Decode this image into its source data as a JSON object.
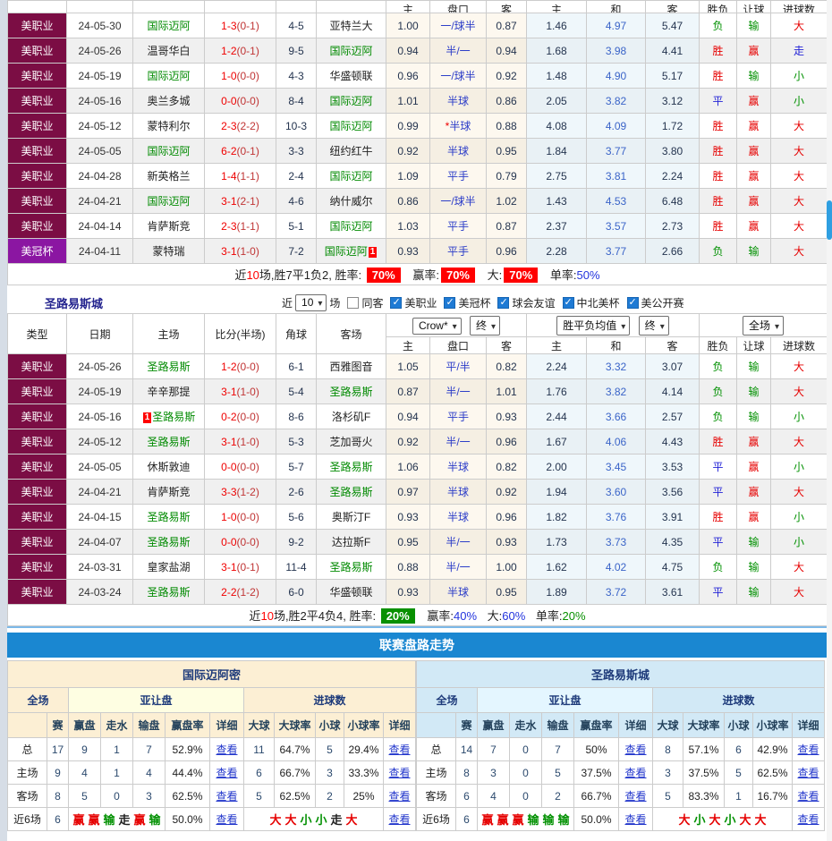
{
  "columns": {
    "left": [
      "类型",
      "日期",
      "主场",
      "比分(半场)",
      "角球",
      "客场"
    ],
    "right": [
      "主",
      "盘口",
      "客",
      "主",
      "和",
      "客",
      "胜负",
      "让球",
      "进球数"
    ]
  },
  "table1": {
    "rows": [
      {
        "league": "美职业",
        "cup": false,
        "date": "24-05-30",
        "home": {
          "name": "国际迈阿",
          "hl": true
        },
        "score": "1-3",
        "half": "(0-1)",
        "corner": "4-5",
        "away": {
          "name": "亚特兰大",
          "hl": false
        },
        "asia": [
          "1.00",
          "一/球半",
          "0.87"
        ],
        "euro": [
          "1.46",
          "4.97",
          "5.47"
        ],
        "result": [
          "负",
          "g"
        ],
        "handicap_result": [
          "输",
          "g"
        ],
        "goal": [
          "大",
          "r"
        ]
      },
      {
        "league": "美职业",
        "cup": false,
        "date": "24-05-26",
        "home": {
          "name": "温哥华白",
          "hl": false
        },
        "score": "1-2",
        "half": "(0-1)",
        "corner": "9-5",
        "away": {
          "name": "国际迈阿",
          "hl": true
        },
        "asia": [
          "0.94",
          "半/一",
          "0.94"
        ],
        "euro": [
          "1.68",
          "3.98",
          "4.41"
        ],
        "result": [
          "胜",
          "r"
        ],
        "handicap_result": [
          "赢",
          "r"
        ],
        "goal": [
          "走",
          "b"
        ]
      },
      {
        "league": "美职业",
        "cup": false,
        "date": "24-05-19",
        "home": {
          "name": "国际迈阿",
          "hl": true
        },
        "score": "1-0",
        "half": "(0-0)",
        "corner": "4-3",
        "away": {
          "name": "华盛顿联",
          "hl": false
        },
        "asia": [
          "0.96",
          "一/球半",
          "0.92"
        ],
        "euro": [
          "1.48",
          "4.90",
          "5.17"
        ],
        "result": [
          "胜",
          "r"
        ],
        "handicap_result": [
          "输",
          "g"
        ],
        "goal": [
          "小",
          "g"
        ]
      },
      {
        "league": "美职业",
        "cup": false,
        "date": "24-05-16",
        "home": {
          "name": "奥兰多城",
          "hl": false
        },
        "score": "0-0",
        "half": "(0-0)",
        "corner": "8-4",
        "away": {
          "name": "国际迈阿",
          "hl": true
        },
        "asia": [
          "1.01",
          "半球",
          "0.86"
        ],
        "euro": [
          "2.05",
          "3.82",
          "3.12"
        ],
        "result": [
          "平",
          "b"
        ],
        "handicap_result": [
          "赢",
          "r"
        ],
        "goal": [
          "小",
          "g"
        ]
      },
      {
        "league": "美职业",
        "cup": false,
        "date": "24-05-12",
        "home": {
          "name": "蒙特利尔",
          "hl": false
        },
        "score": "2-3",
        "half": "(2-2)",
        "corner": "10-3",
        "away": {
          "name": "国际迈阿",
          "hl": true
        },
        "asia": [
          "0.99",
          "*半球",
          "0.88"
        ],
        "euro": [
          "4.08",
          "4.09",
          "1.72"
        ],
        "result": [
          "胜",
          "r"
        ],
        "handicap_result": [
          "赢",
          "r"
        ],
        "goal": [
          "大",
          "r"
        ]
      },
      {
        "league": "美职业",
        "cup": false,
        "date": "24-05-05",
        "home": {
          "name": "国际迈阿",
          "hl": true
        },
        "score": "6-2",
        "half": "(0-1)",
        "corner": "3-3",
        "away": {
          "name": "纽约红牛",
          "hl": false
        },
        "asia": [
          "0.92",
          "半球",
          "0.95"
        ],
        "euro": [
          "1.84",
          "3.77",
          "3.80"
        ],
        "result": [
          "胜",
          "r"
        ],
        "handicap_result": [
          "赢",
          "r"
        ],
        "goal": [
          "大",
          "r"
        ]
      },
      {
        "league": "美职业",
        "cup": false,
        "date": "24-04-28",
        "home": {
          "name": "新英格兰",
          "hl": false
        },
        "score": "1-4",
        "half": "(1-1)",
        "corner": "2-4",
        "away": {
          "name": "国际迈阿",
          "hl": true
        },
        "asia": [
          "1.09",
          "平手",
          "0.79"
        ],
        "euro": [
          "2.75",
          "3.81",
          "2.24"
        ],
        "result": [
          "胜",
          "r"
        ],
        "handicap_result": [
          "赢",
          "r"
        ],
        "goal": [
          "大",
          "r"
        ]
      },
      {
        "league": "美职业",
        "cup": false,
        "date": "24-04-21",
        "home": {
          "name": "国际迈阿",
          "hl": true
        },
        "score": "3-1",
        "half": "(2-1)",
        "corner": "4-6",
        "away": {
          "name": "纳什威尔",
          "hl": false
        },
        "asia": [
          "0.86",
          "一/球半",
          "1.02"
        ],
        "euro": [
          "1.43",
          "4.53",
          "6.48"
        ],
        "result": [
          "胜",
          "r"
        ],
        "handicap_result": [
          "赢",
          "r"
        ],
        "goal": [
          "大",
          "r"
        ]
      },
      {
        "league": "美职业",
        "cup": false,
        "date": "24-04-14",
        "home": {
          "name": "肯萨斯竞",
          "hl": false
        },
        "score": "2-3",
        "half": "(1-1)",
        "corner": "5-1",
        "away": {
          "name": "国际迈阿",
          "hl": true
        },
        "asia": [
          "1.03",
          "平手",
          "0.87"
        ],
        "euro": [
          "2.37",
          "3.57",
          "2.73"
        ],
        "result": [
          "胜",
          "r"
        ],
        "handicap_result": [
          "赢",
          "r"
        ],
        "goal": [
          "大",
          "r"
        ]
      },
      {
        "league": "美冠杯",
        "cup": true,
        "date": "24-04-11",
        "home": {
          "name": "蒙特瑞",
          "hl": false
        },
        "score": "3-1",
        "half": "(1-0)",
        "corner": "7-2",
        "away": {
          "name": "国际迈阿",
          "hl": true,
          "badge": "1",
          "badge_pos": "after"
        },
        "asia": [
          "0.93",
          "平手",
          "0.96"
        ],
        "euro": [
          "2.28",
          "3.77",
          "2.66"
        ],
        "result": [
          "负",
          "g"
        ],
        "handicap_result": [
          "输",
          "g"
        ],
        "goal": [
          "大",
          "r"
        ]
      }
    ],
    "summary": {
      "prefix": "近",
      "count": "10",
      "text": "场,胜7平1负2, 胜率:",
      "win_rate": "70%",
      "label_profit": "赢率:",
      "profit_rate": "70%",
      "label_big": "大:",
      "big_rate": "70%",
      "label_single": "单率:",
      "single_rate": "50%"
    }
  },
  "section2": {
    "title": "圣路易斯城",
    "near_label": "近",
    "games_select": "10",
    "games_label": "场",
    "checkboxes": [
      {
        "label": "同客",
        "checked": false
      },
      {
        "label": "美职业",
        "checked": true
      },
      {
        "label": "美冠杯",
        "checked": true
      },
      {
        "label": "球会友谊",
        "checked": true
      },
      {
        "label": "中北美杯",
        "checked": true
      },
      {
        "label": "美公开赛",
        "checked": true
      }
    ]
  },
  "table2": {
    "selects": {
      "asia_source": "Crow*",
      "asia_state": "终",
      "eu_source": "胜平负均值",
      "eu_state": "终",
      "scope": "全场"
    },
    "rows": [
      {
        "league": "美职业",
        "cup": false,
        "date": "24-05-26",
        "home": {
          "name": "圣路易斯",
          "hl": true
        },
        "score": "1-2",
        "half": "(0-0)",
        "corner": "6-1",
        "away": {
          "name": "西雅图音",
          "hl": false
        },
        "asia": [
          "1.05",
          "平/半",
          "0.82"
        ],
        "euro": [
          "2.24",
          "3.32",
          "3.07"
        ],
        "result": [
          "负",
          "g"
        ],
        "handicap_result": [
          "输",
          "g"
        ],
        "goal": [
          "大",
          "r"
        ]
      },
      {
        "league": "美职业",
        "cup": false,
        "date": "24-05-19",
        "home": {
          "name": "辛辛那提",
          "hl": false
        },
        "score": "3-1",
        "half": "(1-0)",
        "corner": "5-4",
        "away": {
          "name": "圣路易斯",
          "hl": true
        },
        "asia": [
          "0.87",
          "半/一",
          "1.01"
        ],
        "euro": [
          "1.76",
          "3.82",
          "4.14"
        ],
        "result": [
          "负",
          "g"
        ],
        "handicap_result": [
          "输",
          "g"
        ],
        "goal": [
          "大",
          "r"
        ]
      },
      {
        "league": "美职业",
        "cup": false,
        "date": "24-05-16",
        "home": {
          "name": "圣路易斯",
          "hl": true,
          "badge": "1",
          "badge_pos": "before"
        },
        "score": "0-2",
        "half": "(0-0)",
        "corner": "8-6",
        "away": {
          "name": "洛杉矶F",
          "hl": false
        },
        "asia": [
          "0.94",
          "平手",
          "0.93"
        ],
        "euro": [
          "2.44",
          "3.66",
          "2.57"
        ],
        "result": [
          "负",
          "g"
        ],
        "handicap_result": [
          "输",
          "g"
        ],
        "goal": [
          "小",
          "g"
        ]
      },
      {
        "league": "美职业",
        "cup": false,
        "date": "24-05-12",
        "home": {
          "name": "圣路易斯",
          "hl": true
        },
        "score": "3-1",
        "half": "(1-0)",
        "corner": "5-3",
        "away": {
          "name": "芝加哥火",
          "hl": false
        },
        "asia": [
          "0.92",
          "半/一",
          "0.96"
        ],
        "euro": [
          "1.67",
          "4.06",
          "4.43"
        ],
        "result": [
          "胜",
          "r"
        ],
        "handicap_result": [
          "赢",
          "r"
        ],
        "goal": [
          "大",
          "r"
        ]
      },
      {
        "league": "美职业",
        "cup": false,
        "date": "24-05-05",
        "home": {
          "name": "休斯敦迪",
          "hl": false
        },
        "score": "0-0",
        "half": "(0-0)",
        "corner": "5-7",
        "away": {
          "name": "圣路易斯",
          "hl": true
        },
        "asia": [
          "1.06",
          "半球",
          "0.82"
        ],
        "euro": [
          "2.00",
          "3.45",
          "3.53"
        ],
        "result": [
          "平",
          "b"
        ],
        "handicap_result": [
          "赢",
          "r"
        ],
        "goal": [
          "小",
          "g"
        ]
      },
      {
        "league": "美职业",
        "cup": false,
        "date": "24-04-21",
        "home": {
          "name": "肯萨斯竞",
          "hl": false
        },
        "score": "3-3",
        "half": "(1-2)",
        "corner": "2-6",
        "away": {
          "name": "圣路易斯",
          "hl": true
        },
        "asia": [
          "0.97",
          "半球",
          "0.92"
        ],
        "euro": [
          "1.94",
          "3.60",
          "3.56"
        ],
        "result": [
          "平",
          "b"
        ],
        "handicap_result": [
          "赢",
          "r"
        ],
        "goal": [
          "大",
          "r"
        ]
      },
      {
        "league": "美职业",
        "cup": false,
        "date": "24-04-15",
        "home": {
          "name": "圣路易斯",
          "hl": true
        },
        "score": "1-0",
        "half": "(0-0)",
        "corner": "5-6",
        "away": {
          "name": "奥斯汀F",
          "hl": false
        },
        "asia": [
          "0.93",
          "半球",
          "0.96"
        ],
        "euro": [
          "1.82",
          "3.76",
          "3.91"
        ],
        "result": [
          "胜",
          "r"
        ],
        "handicap_result": [
          "赢",
          "r"
        ],
        "goal": [
          "小",
          "g"
        ]
      },
      {
        "league": "美职业",
        "cup": false,
        "date": "24-04-07",
        "home": {
          "name": "圣路易斯",
          "hl": true
        },
        "score": "0-0",
        "half": "(0-0)",
        "corner": "9-2",
        "away": {
          "name": "达拉斯F",
          "hl": false
        },
        "asia": [
          "0.95",
          "半/一",
          "0.93"
        ],
        "euro": [
          "1.73",
          "3.73",
          "4.35"
        ],
        "result": [
          "平",
          "b"
        ],
        "handicap_result": [
          "输",
          "g"
        ],
        "goal": [
          "小",
          "g"
        ]
      },
      {
        "league": "美职业",
        "cup": false,
        "date": "24-03-31",
        "home": {
          "name": "皇家盐湖",
          "hl": false
        },
        "score": "3-1",
        "half": "(0-1)",
        "corner": "11-4",
        "away": {
          "name": "圣路易斯",
          "hl": true
        },
        "asia": [
          "0.88",
          "半/一",
          "1.00"
        ],
        "euro": [
          "1.62",
          "4.02",
          "4.75"
        ],
        "result": [
          "负",
          "g"
        ],
        "handicap_result": [
          "输",
          "g"
        ],
        "goal": [
          "大",
          "r"
        ]
      },
      {
        "league": "美职业",
        "cup": false,
        "date": "24-03-24",
        "home": {
          "name": "圣路易斯",
          "hl": true
        },
        "score": "2-2",
        "half": "(1-2)",
        "corner": "6-0",
        "away": {
          "name": "华盛顿联",
          "hl": false
        },
        "asia": [
          "0.93",
          "半球",
          "0.95"
        ],
        "euro": [
          "1.89",
          "3.72",
          "3.61"
        ],
        "result": [
          "平",
          "b"
        ],
        "handicap_result": [
          "输",
          "g"
        ],
        "goal": [
          "大",
          "r"
        ]
      }
    ],
    "summary": {
      "prefix": "近",
      "count": "10",
      "text": "场,胜2平4负4, 胜率:",
      "win_rate": "20%",
      "label_profit": "赢率:",
      "profit_rate": "40%",
      "label_big": "大:",
      "big_rate": "60%",
      "label_single": "单率:",
      "single_rate": "20%"
    }
  },
  "trend": {
    "banner": "联赛盘路走势",
    "groups": {
      "full": "全场",
      "handicap": "亚让盘",
      "goals": "进球数"
    },
    "columns": [
      "赛",
      "赢盘",
      "走水",
      "输盘",
      "赢盘率",
      "详细",
      "大球",
      "大球率",
      "小球",
      "小球率",
      "详细"
    ],
    "view_label": "查看",
    "left": {
      "title": "国际迈阿密",
      "rows": [
        {
          "label": "总",
          "games": "17",
          "win": "9",
          "push": "1",
          "lose": "7",
          "win_rate": "52.9%",
          "big": "11",
          "big_rate": "64.7%",
          "small": "5",
          "small_rate": "29.4%"
        },
        {
          "label": "主场",
          "games": "9",
          "win": "4",
          "push": "1",
          "lose": "4",
          "win_rate": "44.4%",
          "big": "6",
          "big_rate": "66.7%",
          "small": "3",
          "small_rate": "33.3%"
        },
        {
          "label": "客场",
          "games": "8",
          "win": "5",
          "push": "0",
          "lose": "3",
          "win_rate": "62.5%",
          "big": "5",
          "big_rate": "62.5%",
          "small": "2",
          "small_rate": "25%"
        }
      ],
      "recent": {
        "label": "近6场",
        "games": "6",
        "seq": [
          [
            "赢",
            "r"
          ],
          [
            "赢",
            "r"
          ],
          [
            "输",
            "g"
          ],
          [
            "走",
            "b"
          ],
          [
            "赢",
            "r"
          ],
          [
            "输",
            "g"
          ]
        ],
        "rate": "50.0%",
        "goal_seq": [
          [
            "大",
            "r"
          ],
          [
            "大",
            "r"
          ],
          [
            "小",
            "g"
          ],
          [
            "小",
            "g"
          ],
          [
            "走",
            "b"
          ],
          [
            "大",
            "r"
          ]
        ]
      }
    },
    "right": {
      "title": "圣路易斯城",
      "rows": [
        {
          "label": "总",
          "games": "14",
          "win": "7",
          "push": "0",
          "lose": "7",
          "win_rate": "50%",
          "big": "8",
          "big_rate": "57.1%",
          "small": "6",
          "small_rate": "42.9%"
        },
        {
          "label": "主场",
          "games": "8",
          "win": "3",
          "push": "0",
          "lose": "5",
          "win_rate": "37.5%",
          "big": "3",
          "big_rate": "37.5%",
          "small": "5",
          "small_rate": "62.5%"
        },
        {
          "label": "客场",
          "games": "6",
          "win": "4",
          "push": "0",
          "lose": "2",
          "win_rate": "66.7%",
          "big": "5",
          "big_rate": "83.3%",
          "small": "1",
          "small_rate": "16.7%"
        }
      ],
      "recent": {
        "label": "近6场",
        "games": "6",
        "seq": [
          [
            "赢",
            "r"
          ],
          [
            "赢",
            "r"
          ],
          [
            "赢",
            "r"
          ],
          [
            "输",
            "g"
          ],
          [
            "输",
            "g"
          ],
          [
            "输",
            "g"
          ]
        ],
        "rate": "50.0%",
        "goal_seq": [
          [
            "大",
            "r"
          ],
          [
            "小",
            "g"
          ],
          [
            "大",
            "r"
          ],
          [
            "小",
            "g"
          ],
          [
            "大",
            "r"
          ],
          [
            "大",
            "r"
          ]
        ]
      }
    }
  }
}
